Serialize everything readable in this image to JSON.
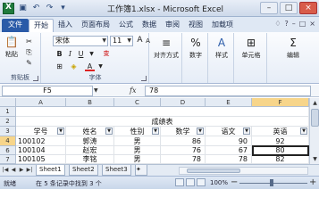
{
  "window": {
    "title": "工作簿1.xlsx - Microsoft Excel",
    "app_icon": "X",
    "qat": [
      "save-icon",
      "undo-icon",
      "redo-icon",
      "customize-icon"
    ],
    "qat_glyphs": [
      "▣",
      "↶",
      "↷",
      "▾"
    ],
    "controls": [
      "–",
      "□",
      "×"
    ]
  },
  "ribbon_tabs": [
    "文件",
    "开始",
    "插入",
    "页面布局",
    "公式",
    "数据",
    "审阅",
    "视图",
    "加载项"
  ],
  "ribbon_tabs_right": [
    "♢",
    "?",
    "–",
    "□",
    "×"
  ],
  "ribbon": {
    "clipboard": {
      "paste": "粘贴",
      "group": "剪贴板"
    },
    "font": {
      "name": "宋体",
      "size": "11",
      "bold": "B",
      "italic": "I",
      "underline": "U",
      "grow": "A",
      "shrink": "A",
      "border": "⊞",
      "fill": "◈",
      "color": "A",
      "wen": "变",
      "group": "字体"
    },
    "alignment": {
      "label": "对齐方式"
    },
    "number": {
      "label": "数字",
      "glyph": "%"
    },
    "styles": {
      "label": "样式",
      "glyph": "A"
    },
    "cells": {
      "label": "单元格",
      "glyph": "⊞"
    },
    "editing": {
      "label": "编辑",
      "glyph": "Σ"
    }
  },
  "formula_bar": {
    "name_box": "F5",
    "fx": "fx",
    "value": "78"
  },
  "columns": [
    "A",
    "B",
    "C",
    "D",
    "E",
    "F"
  ],
  "rows": [
    "1",
    "2",
    "3",
    "4",
    "6",
    "7"
  ],
  "sheet": {
    "title": "成绩表",
    "headers": [
      "学号",
      "姓名",
      "性别",
      "数学",
      "语文",
      "英语"
    ],
    "records": [
      [
        "100102",
        "郭涛",
        "男",
        "86",
        "90",
        "92"
      ],
      [
        "100104",
        "赵宏",
        "男",
        "76",
        "67",
        "80"
      ],
      [
        "100105",
        "李铭",
        "男",
        "78",
        "78",
        "82"
      ]
    ]
  },
  "sheet_tabs": [
    "Sheet1",
    "Sheet2",
    "Sheet3"
  ],
  "status": {
    "mode": "就绪",
    "message": "在 5 条记录中找到 3 个",
    "zoom": "100%"
  }
}
